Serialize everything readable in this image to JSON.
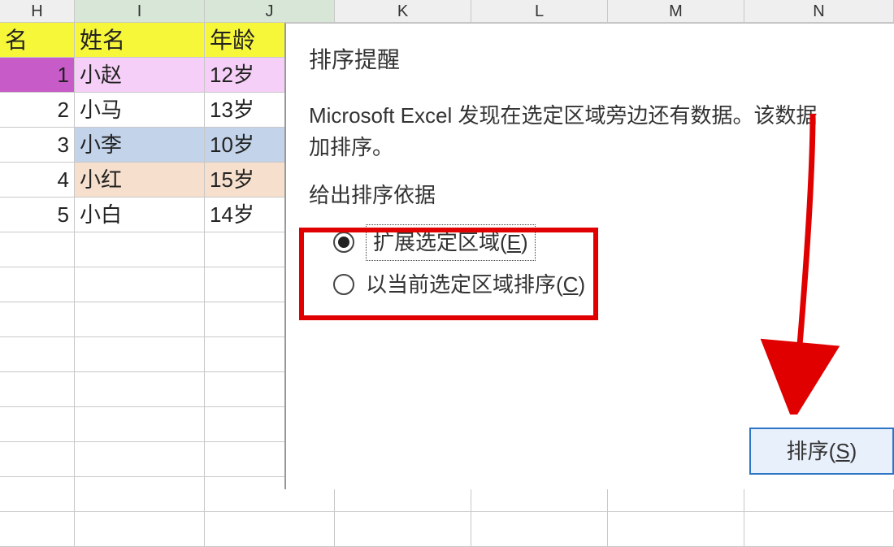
{
  "columns": {
    "H": "H",
    "I": "I",
    "J": "J",
    "K": "K",
    "L": "L",
    "M": "M",
    "N": "N"
  },
  "headers": {
    "H": "名",
    "I": "姓名",
    "J": "年龄"
  },
  "rows": [
    {
      "H": "1",
      "I": "小赵",
      "J": "12岁",
      "fillH": "#c75bc7",
      "fillIJ": "#f5cff7"
    },
    {
      "H": "2",
      "I": "小马",
      "J": "13岁",
      "fillH": "#ffffff",
      "fillIJ": "#ffffff"
    },
    {
      "H": "3",
      "I": "小李",
      "J": "10岁",
      "fillH": "#ffffff",
      "fillIJ": "#c3d3ea"
    },
    {
      "H": "4",
      "I": "小红",
      "J": "15岁",
      "fillH": "#ffffff",
      "fillIJ": "#f6e0cd"
    },
    {
      "H": "5",
      "I": "小白",
      "J": "14岁",
      "fillH": "#ffffff",
      "fillIJ": "#ffffff"
    }
  ],
  "header_fill": "#f7f73a",
  "dialog": {
    "title": "排序提醒",
    "message_line1": "Microsoft Excel 发现在选定区域旁边还有数据。该数据",
    "message_line2": "加排序。",
    "group_label": "给出排序依据",
    "option_expand": {
      "label_pre": "扩展选定区域(",
      "accel": "E",
      "label_post": ")",
      "selected": true
    },
    "option_current": {
      "label_pre": "以当前选定区域排序(",
      "accel": "C",
      "label_post": ")",
      "selected": false
    },
    "sort_button": {
      "label_pre": "排序(",
      "accel": "S",
      "label_post": ")"
    }
  }
}
